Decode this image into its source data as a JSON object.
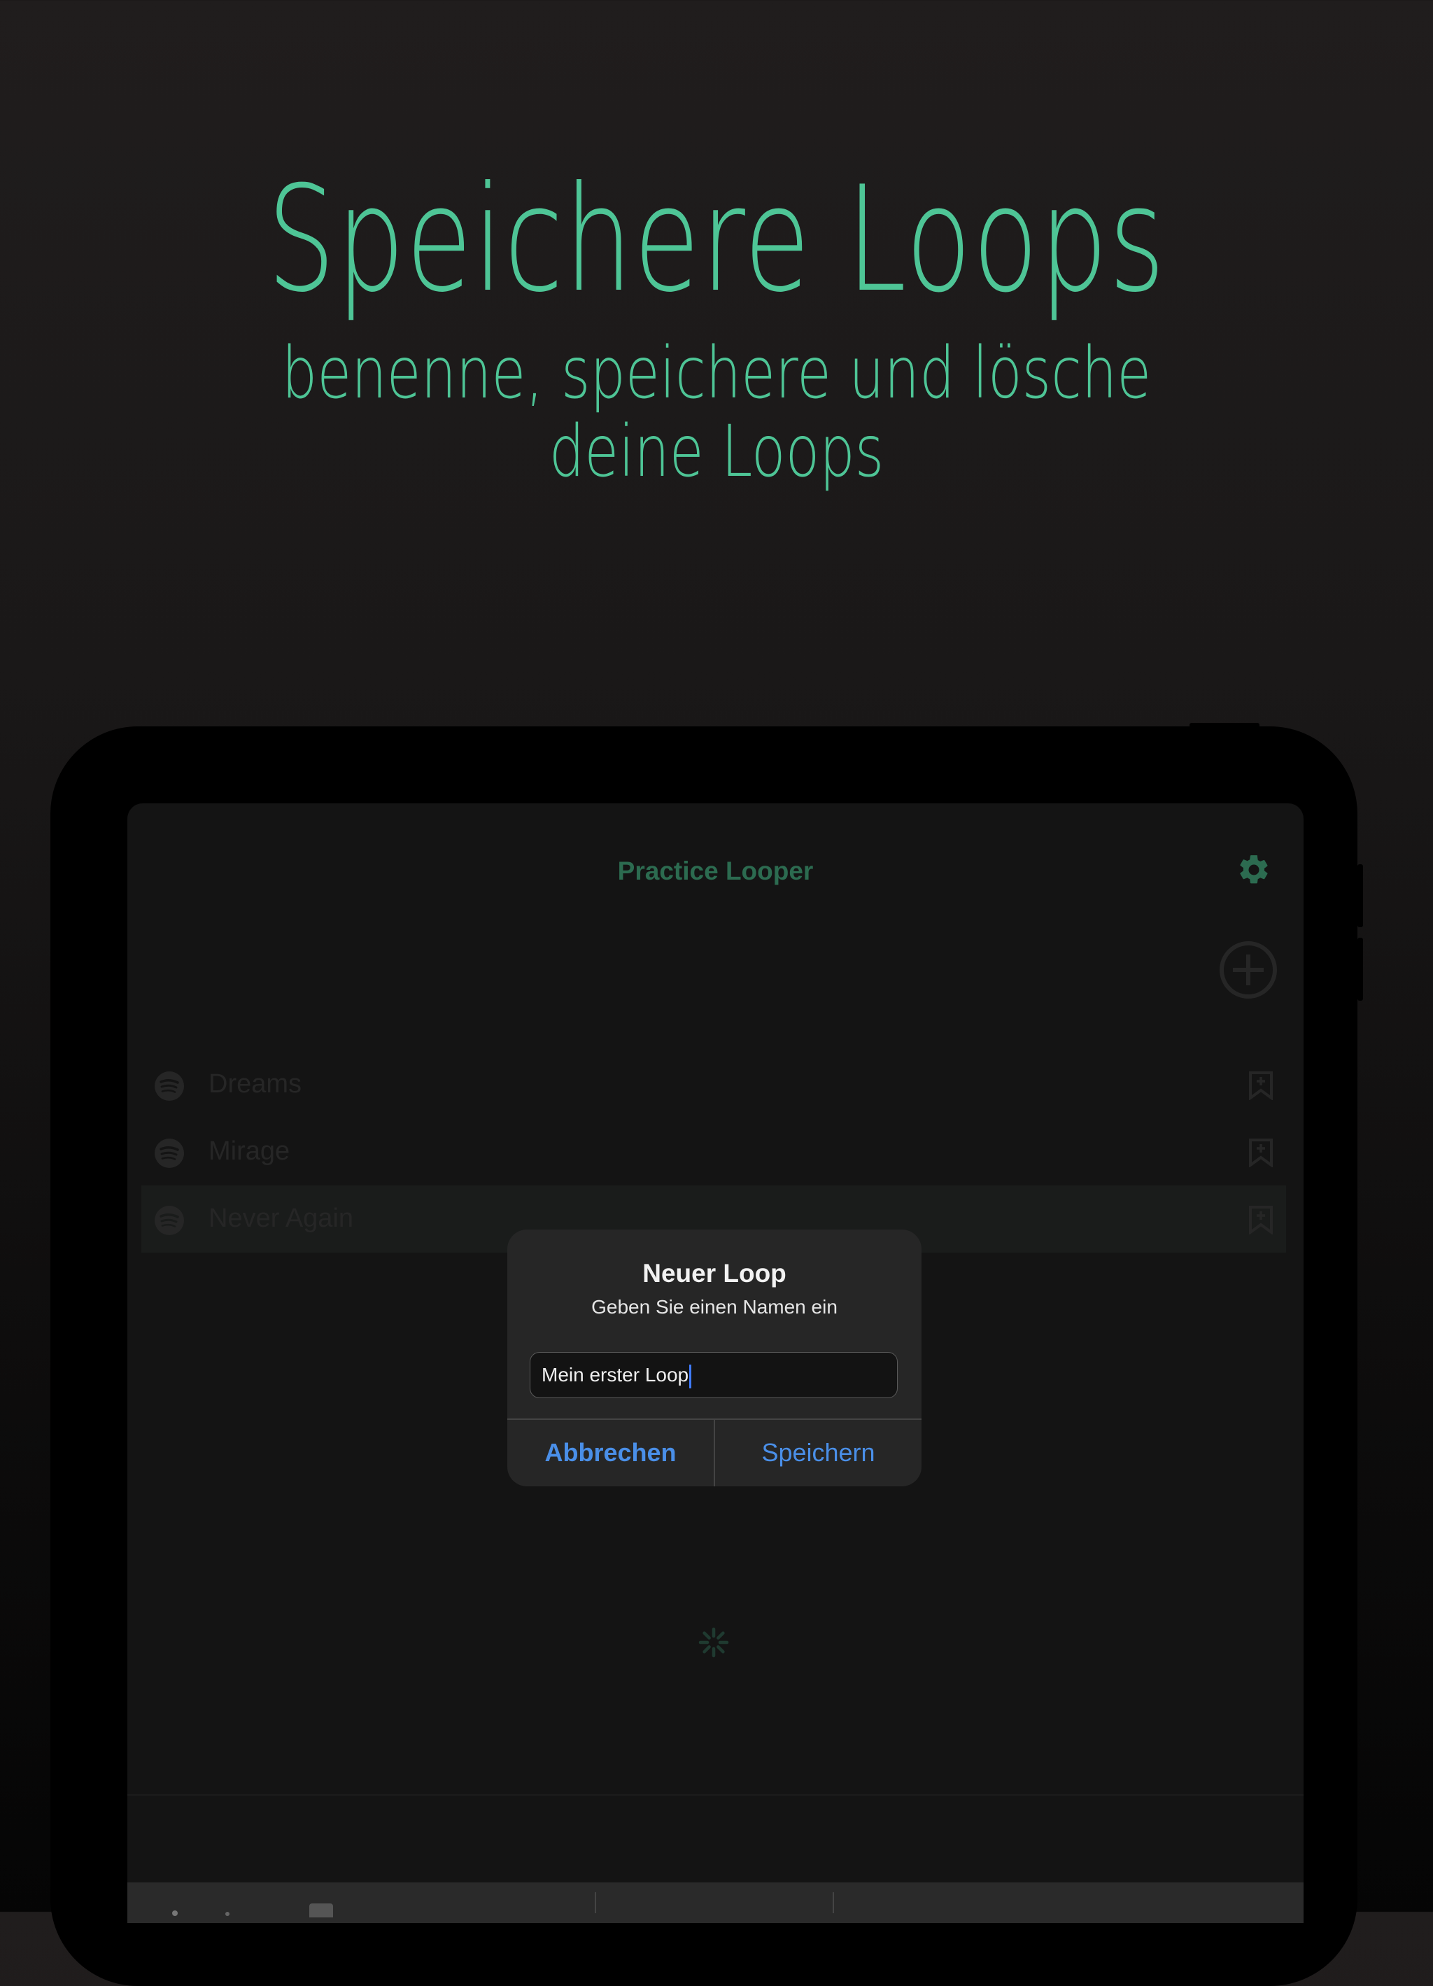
{
  "hero": {
    "title": "Speichere Loops",
    "subtitle": "benenne, speichere und lösche deine Loops"
  },
  "app": {
    "nav_title": "Practice Looper",
    "settings_icon": "gear-icon",
    "add_icon": "plus-circle-icon"
  },
  "songs": [
    {
      "name": "Dreams",
      "icon": "spotify-icon",
      "action_icon": "bookmark-icon"
    },
    {
      "name": "Mirage",
      "icon": "spotify-icon",
      "action_icon": "bookmark-icon"
    },
    {
      "name": "Never Again",
      "icon": "spotify-icon",
      "action_icon": "bookmark-icon",
      "selected": true
    }
  ],
  "dialog": {
    "title": "Neuer Loop",
    "message": "Geben Sie einen Namen ein",
    "input_value": "Mein erster Loop",
    "cancel_label": "Abbrechen",
    "save_label": "Speichern"
  },
  "colors": {
    "accent": "#4ec596",
    "dialog_button": "#4a8fe8",
    "background": "#1c1a1a"
  }
}
